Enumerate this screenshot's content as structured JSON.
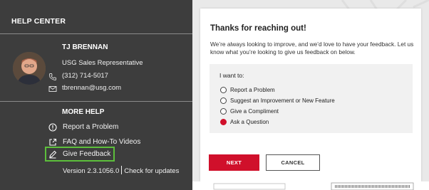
{
  "help_panel": {
    "header": "HELP CENTER",
    "contact": {
      "name": "TJ BRENNAN",
      "role": "USG Sales Representative",
      "phone": "(312) 714-5017",
      "email": "tbrennan@usg.com"
    },
    "more_help": {
      "title": "MORE HELP",
      "links": [
        {
          "label": "Report a Problem",
          "icon": "exclamation-circle-icon"
        },
        {
          "label": "FAQ and How-To Videos",
          "icon": "external-link-icon"
        },
        {
          "label": "Give Feedback",
          "icon": "pencil-icon"
        }
      ]
    },
    "version": "Version 2.3.1056.0",
    "check_updates": "Check for updates",
    "highlight_color": "#5cbf3b"
  },
  "dialog": {
    "title": "Thanks for reaching out!",
    "text": "We’re always looking to improve, and we’d love to have your feedback. Let us know what you’re looking to give us feedback on below.",
    "form_label": "I want to:",
    "options": [
      {
        "label": "Report a Problem",
        "selected": false
      },
      {
        "label": "Suggest an Improvement or New Feature",
        "selected": false
      },
      {
        "label": "Give a Compliment",
        "selected": false
      },
      {
        "label": "Ask a Question",
        "selected": true
      }
    ],
    "next_label": "NEXT",
    "cancel_label": "CANCEL",
    "accent_color": "#d0102b"
  }
}
